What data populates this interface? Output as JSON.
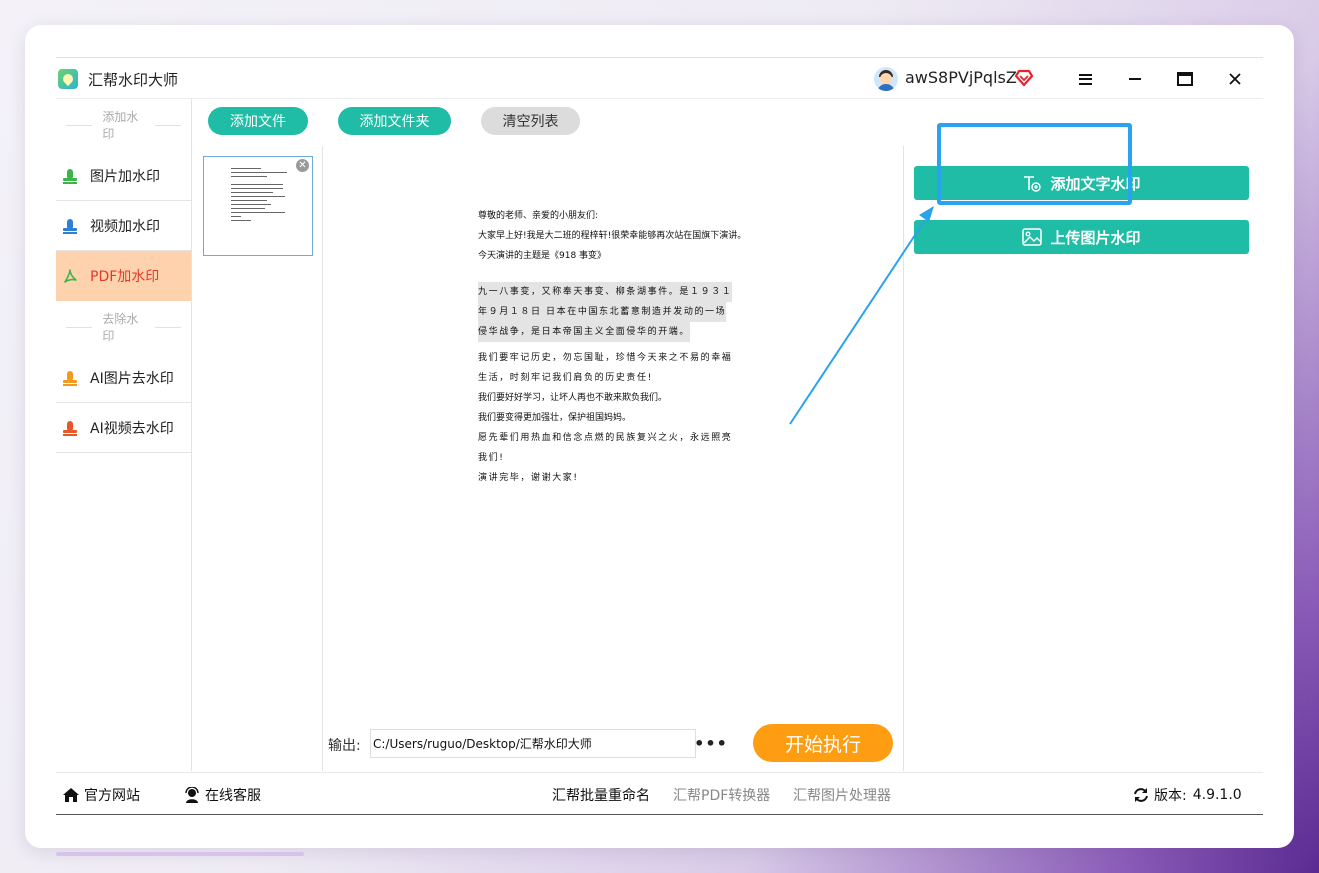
{
  "app": {
    "title": "汇帮水印大师",
    "username": "awS8PVjPqlsZ"
  },
  "window_controls": [
    "menu",
    "minimize",
    "maximize",
    "close"
  ],
  "sidebar": {
    "add_header": "添加水印",
    "remove_header": "去除水印",
    "add_items": [
      {
        "label": "图片加水印",
        "icon": "stamp-icon",
        "color": "#3bb54a"
      },
      {
        "label": "视频加水印",
        "icon": "stamp-icon",
        "color": "#2f7fd6"
      },
      {
        "label": "PDF加水印",
        "icon": "pdf-icon",
        "color": "#3bb54a",
        "active": true
      }
    ],
    "remove_items": [
      {
        "label": "AI图片去水印",
        "icon": "stamp-icon",
        "color": "#f39a1e"
      },
      {
        "label": "AI视频去水印",
        "icon": "stamp-icon",
        "color": "#e8562a"
      }
    ]
  },
  "toolbar": {
    "add_file": "添加文件",
    "add_folder": "添加文件夹",
    "clear_list": "清空列表"
  },
  "preview_doc": {
    "intro": [
      "尊敬的老师、亲爱的小朋友们:",
      "大家早上好!我是大二班的程梓轩!很荣幸能够再次站在国旗下演讲。",
      "今天演讲的主题是《918 事变》"
    ],
    "highlighted": [
      "九一八事变，又称奉天事变、柳条湖事件。是１９３１",
      "年９月１８日 日本在中国东北蓄意制造并发动的一场",
      "侵华战争，是日本帝国主义全面侵华的开端。"
    ],
    "body": [
      {
        "text": "我们要牢记历史，勿忘国耻，珍惜今天来之不易的幸福",
        "spaced": true
      },
      {
        "text": "生活，时刻牢记我们肩负的历史责任!",
        "spaced": true
      },
      {
        "text": "我们要好好学习，让坏人再也不敢来欺负我们。",
        "spaced": false
      },
      {
        "text": "我们要变得更加强壮，保护祖国妈妈。",
        "spaced": false
      },
      {
        "text": "愿先辈们用热血和信念点燃的民族复兴之火，永远照亮",
        "spaced": true
      },
      {
        "text": "我们!",
        "spaced": true
      },
      {
        "text": "演讲完毕，谢谢大家!",
        "spaced": true
      }
    ]
  },
  "right_panel": {
    "add_text_watermark": "添加文字水印",
    "upload_image_watermark": "上传图片水印"
  },
  "output": {
    "label": "输出:",
    "path": "C:/Users/ruguo/Desktop/汇帮水印大师",
    "browse": "•••",
    "start": "开始执行"
  },
  "footer": {
    "website": "官方网站",
    "service": "在线客服",
    "rename_tool": "汇帮批量重命名",
    "pdf_tool": "汇帮PDF转换器",
    "image_tool": "汇帮图片处理器",
    "version_label": "版本:",
    "version": "4.9.1.0"
  },
  "colors": {
    "accent_teal": "#1fbca6",
    "start_orange": "#ff9d12",
    "active_bg": "#ffd2ae",
    "active_text": "#e23a2c",
    "annotation_blue": "#2aa3ef"
  }
}
